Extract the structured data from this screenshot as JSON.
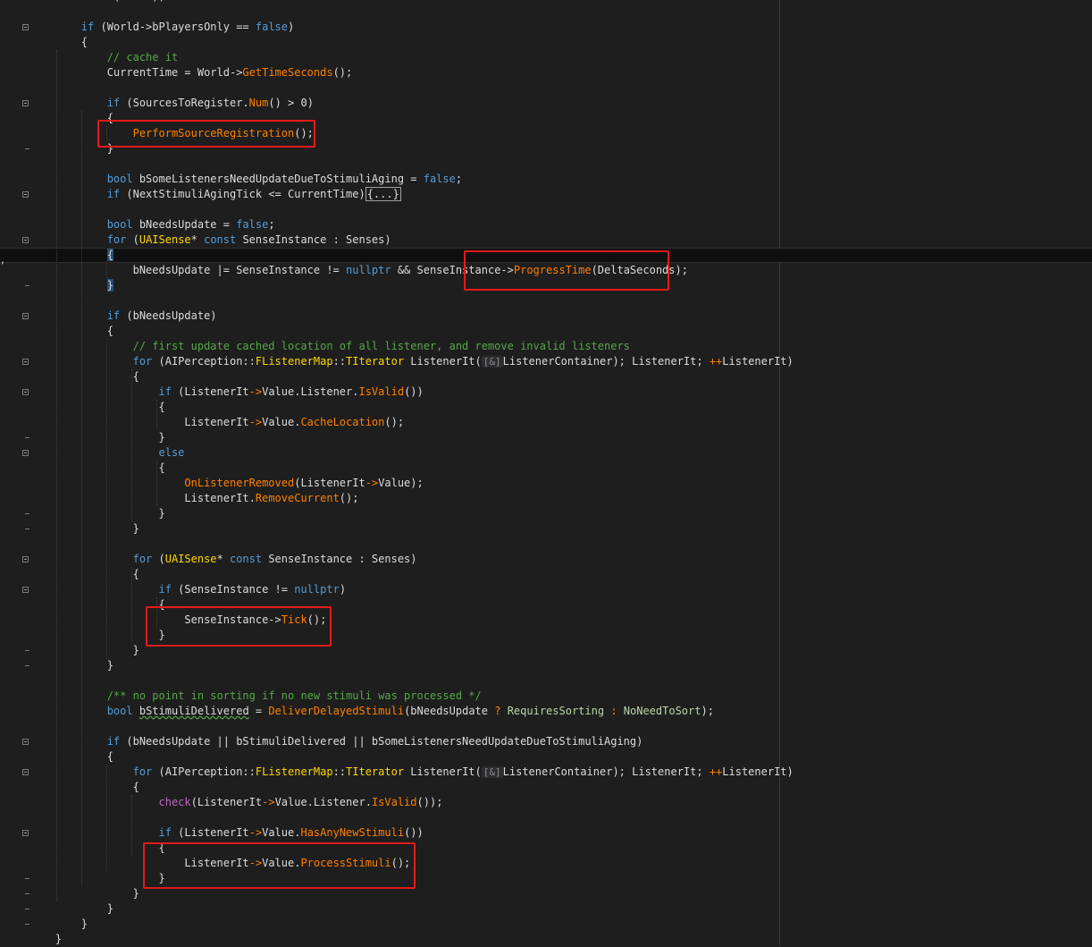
{
  "editor": {
    "language": "C++",
    "lines": [
      "        check(World);",
      "",
      "        if (World->bPlayersOnly == false)",
      "        {",
      "            // cache it",
      "            CurrentTime = World->GetTimeSeconds();",
      "",
      "            if (SourcesToRegister.Num() > 0)",
      "            {",
      "                PerformSourceRegistration();",
      "            }",
      "",
      "            bool bSomeListenersNeedUpdateDueToStimuliAging = false;",
      "            if (NextStimuliAgingTick <= CurrentTime){...}",
      "",
      "            bool bNeedsUpdate = false;",
      "            for (UAISense* const SenseInstance : Senses)",
      "            {",
      "                bNeedsUpdate |= SenseInstance != nullptr && SenseInstance->ProgressTime(DeltaSeconds);",
      "            }",
      "",
      "            if (bNeedsUpdate)",
      "            {",
      "                // first update cached location of all listener, and remove invalid listeners",
      "                for (AIPerception::FListenerMap::TIterator ListenerIt([&]ListenerContainer); ListenerIt; ++ListenerIt)",
      "                {",
      "                    if (ListenerIt->Value.Listener.IsValid())",
      "                    {",
      "                        ListenerIt->Value.CacheLocation();",
      "                    }",
      "                    else",
      "                    {",
      "                        OnListenerRemoved(ListenerIt->Value);",
      "                        ListenerIt.RemoveCurrent();",
      "                    }",
      "                }",
      "",
      "                for (UAISense* const SenseInstance : Senses)",
      "                {",
      "                    if (SenseInstance != nullptr)",
      "                    {",
      "                        SenseInstance->Tick();",
      "                    }",
      "                }",
      "            }",
      "",
      "            /** no point in sorting if no new stimuli was processed */",
      "            bool bStimuliDelivered = DeliverDelayedStimuli(bNeedsUpdate ? RequiresSorting : NoNeedToSort);",
      "",
      "            if (bNeedsUpdate || bStimuliDelivered || bSomeListenersNeedUpdateDueToStimuliAging)",
      "            {",
      "                for (AIPerception::FListenerMap::TIterator ListenerIt([&]ListenerContainer); ListenerIt; ++ListenerIt)",
      "                {",
      "                    check(ListenerIt->Value.Listener.IsValid());",
      "",
      "                    if (ListenerIt->Value.HasAnyNewStimuli())",
      "                    {",
      "                        ListenerIt->Value.ProcessStimuli();",
      "                    }",
      "                }",
      "            }",
      "        }",
      "    }"
    ]
  },
  "highlights": [
    {
      "label": "PerformSourceRegistration();"
    },
    {
      "label": "ProgressTime(DeltaSeconds);"
    },
    {
      "label": "SenseInstance->Tick();"
    },
    {
      "label": "ListenerIt->Value.ProcessStimuli();"
    }
  ],
  "colors": {
    "background": "#1e1e1e",
    "keyword": "#569cd6",
    "function": "#ff8000",
    "type": "#ffd700",
    "comment": "#57a64a",
    "text": "#dcdcdc",
    "highlight_box": "#e51a1a"
  }
}
